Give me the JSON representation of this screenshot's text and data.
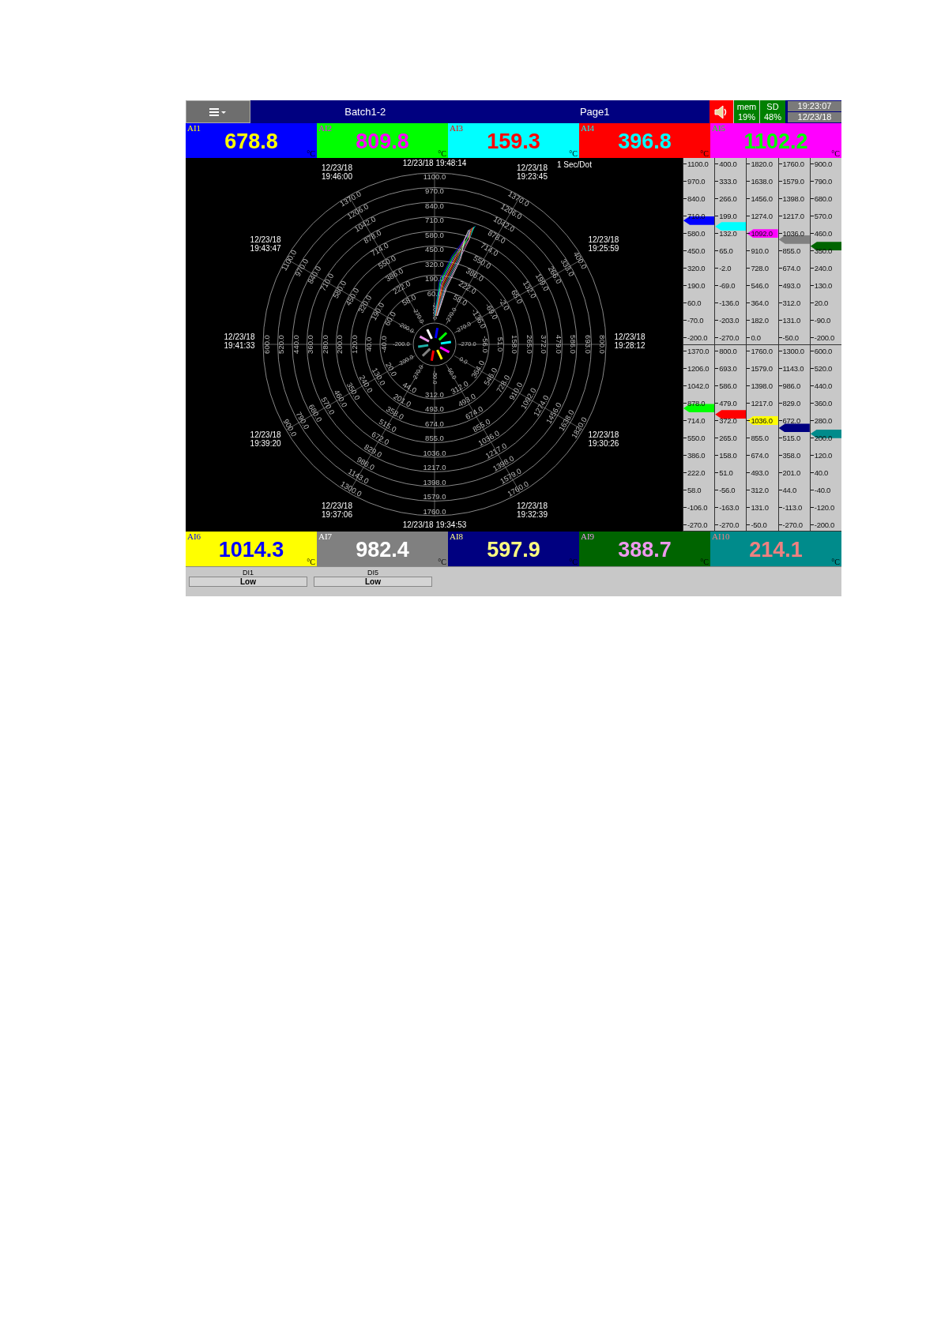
{
  "header": {
    "title": "Batch1-2",
    "page": "Page1",
    "memory": {
      "label": "mem",
      "value": "19%"
    },
    "sd": {
      "label": "SD",
      "value": "48%"
    },
    "clock": {
      "time": "19:23:07",
      "date": "12/23/18"
    }
  },
  "channels_top": [
    {
      "name": "AI1",
      "value": "678.8",
      "unit": "°C",
      "color": "#0000ff"
    },
    {
      "name": "AI2",
      "value": "809.8",
      "unit": "°C",
      "color": "#00ff00"
    },
    {
      "name": "AI3",
      "value": "159.3",
      "unit": "°C",
      "color": "#00ffff"
    },
    {
      "name": "AI4",
      "value": "396.8",
      "unit": "°C",
      "color": "#ff0000"
    },
    {
      "name": "AI5",
      "value": "1102.2",
      "unit": "°C",
      "color": "#ff00ff"
    }
  ],
  "chart": {
    "rate": "1 Sec/Dot",
    "spokes": [
      {
        "date": "12/23/18",
        "time": "19:48:14",
        "labels": [
          "1100.0",
          "970.0",
          "840.0",
          "710.0",
          "580.0",
          "450.0",
          "320.0",
          "190.0",
          "60.0",
          "-200.0"
        ]
      },
      {
        "date": "12/23/18",
        "time": "19:23:45",
        "labels": [
          "1370.0",
          "1206.0",
          "1042.0",
          "878.0",
          "714.0",
          "550.0",
          "386.0",
          "222.0",
          "58.0",
          "-270.0"
        ]
      },
      {
        "date": "12/23/18",
        "time": "19:25:59",
        "labels": [
          "400.0",
          "333.0",
          "266.0",
          "199.0",
          "132.0",
          "65.0",
          "-2.0",
          "-69.0",
          "-136.0",
          "-270.0"
        ]
      },
      {
        "date": "12/23/18",
        "time": "19:28:12",
        "labels": [
          "800.0",
          "693.0",
          "586.0",
          "479.0",
          "372.0",
          "265.0",
          "158.0",
          "51.0",
          "-56.0",
          "-270.0"
        ]
      },
      {
        "date": "12/23/18",
        "time": "19:30:26",
        "labels": [
          "0.0",
          "364.0",
          "546.0",
          "728.0",
          "910.0",
          "1092.0",
          "1274.0",
          "1456.0",
          "1638.0",
          "1820.0"
        ]
      },
      {
        "date": "12/23/18",
        "time": "19:32:39",
        "labels": [
          "-50.0",
          "312.0",
          "493.0",
          "674.0",
          "855.0",
          "1036.0",
          "1217.0",
          "1398.0",
          "1579.0",
          "1760.0"
        ]
      },
      {
        "date": "12/23/18",
        "time": "19:34:53",
        "labels": [
          "-50.0",
          "312.0",
          "493.0",
          "674.0",
          "855.0",
          "1036.0",
          "1217.0",
          "1398.0",
          "1579.0",
          "1760.0"
        ]
      },
      {
        "date": "12/23/18",
        "time": "19:37:06",
        "labels": [
          "-270.0",
          "44.0",
          "201.0",
          "358.0",
          "515.0",
          "672.0",
          "829.0",
          "986.0",
          "1143.0",
          "1300.0"
        ]
      },
      {
        "date": "12/23/18",
        "time": "19:39:20",
        "labels": [
          "-200.0",
          "20.0",
          "130.0",
          "240.0",
          "350.0",
          "460.0",
          "570.0",
          "680.0",
          "790.0",
          "900.0"
        ]
      },
      {
        "date": "12/23/18",
        "time": "19:41:33",
        "labels": [
          "600.0",
          "520.0",
          "440.0",
          "360.0",
          "280.0",
          "200.0",
          "120.0",
          "40.0",
          "-40.0",
          "-200.0"
        ]
      },
      {
        "date": "12/23/18",
        "time": "19:43:47",
        "labels": [
          "1100.0",
          "970.0",
          "840.0",
          "710.0",
          "580.0",
          "450.0",
          "320.0",
          "190.0",
          "60.0",
          "-200.0"
        ]
      },
      {
        "date": "12/23/18",
        "time": "19:46:00",
        "labels": [
          "1370.0",
          "1206.0",
          "1042.0",
          "878.0",
          "714.0",
          "550.0",
          "386.0",
          "222.0",
          "58.0",
          "-270.0"
        ]
      }
    ]
  },
  "scales": [
    [
      {
        "color": "#0000ff",
        "level": 0.677,
        "labels": [
          "1100.0",
          "970.0",
          "840.0",
          "710.0",
          "580.0",
          "450.0",
          "320.0",
          "190.0",
          "60.0",
          "-70.0",
          "-200.0"
        ]
      },
      {
        "color": "#00ffff",
        "level": 0.644,
        "labels": [
          "400.0",
          "333.0",
          "266.0",
          "199.0",
          "132.0",
          "65.0",
          "-2.0",
          "-69.0",
          "-136.0",
          "-203.0",
          "-270.0"
        ]
      },
      {
        "color": "#ff00ff",
        "level": 0.603,
        "labels": [
          "1820.0",
          "1638.0",
          "1456.0",
          "1274.0",
          "1092.0",
          "910.0",
          "728.0",
          "546.0",
          "364.0",
          "182.0",
          "0.0"
        ]
      },
      {
        "color": "#808080",
        "level": 0.57,
        "labels": [
          "1760.0",
          "1579.0",
          "1398.0",
          "1217.0",
          "1036.0",
          "855.0",
          "674.0",
          "493.0",
          "312.0",
          "131.0",
          "-50.0"
        ]
      },
      {
        "color": "#006400",
        "level": 0.532,
        "labels": [
          "900.0",
          "790.0",
          "680.0",
          "570.0",
          "460.0",
          "350.0",
          "240.0",
          "130.0",
          "20.0",
          "-90.0",
          "-200.0"
        ]
      }
    ],
    [
      {
        "color": "#00ff00",
        "level": 0.672,
        "labels": [
          "1370.0",
          "1206.0",
          "1042.0",
          "878.0",
          "714.0",
          "550.0",
          "386.0",
          "222.0",
          "58.0",
          "-106.0",
          "-270.0"
        ]
      },
      {
        "color": "#ff0000",
        "level": 0.637,
        "labels": [
          "800.0",
          "693.0",
          "586.0",
          "479.0",
          "372.0",
          "265.0",
          "158.0",
          "51.0",
          "-56.0",
          "-163.0",
          "-270.0"
        ]
      },
      {
        "color": "#ffff00",
        "level": 0.602,
        "labels": [
          "1760.0",
          "1579.0",
          "1398.0",
          "1217.0",
          "1036.0",
          "855.0",
          "674.0",
          "493.0",
          "312.0",
          "131.0",
          "-50.0"
        ]
      },
      {
        "color": "#000080",
        "level": 0.56,
        "labels": [
          "1300.0",
          "1143.0",
          "986.0",
          "829.0",
          "672.0",
          "515.0",
          "358.0",
          "201.0",
          "44.0",
          "-113.0",
          "-270.0"
        ]
      },
      {
        "color": "#008b8b",
        "level": 0.527,
        "labels": [
          "600.0",
          "520.0",
          "440.0",
          "360.0",
          "280.0",
          "200.0",
          "120.0",
          "40.0",
          "-40.0",
          "-120.0",
          "-200.0"
        ]
      }
    ]
  ],
  "channels_bottom": [
    {
      "name": "AI6",
      "value": "1014.3",
      "unit": "°C",
      "color": "#ffff00"
    },
    {
      "name": "AI7",
      "value": "982.4",
      "unit": "°C",
      "color": "#808080"
    },
    {
      "name": "AI8",
      "value": "597.9",
      "unit": "°C",
      "color": "#000080"
    },
    {
      "name": "AI9",
      "value": "388.7",
      "unit": "°C",
      "color": "#006400"
    },
    {
      "name": "AI10",
      "value": "214.1",
      "unit": "°C",
      "color": "#008b8b"
    }
  ],
  "digital_inputs": [
    {
      "name": "DI1",
      "state": "Low"
    },
    {
      "name": "DI5",
      "state": "Low"
    }
  ]
}
